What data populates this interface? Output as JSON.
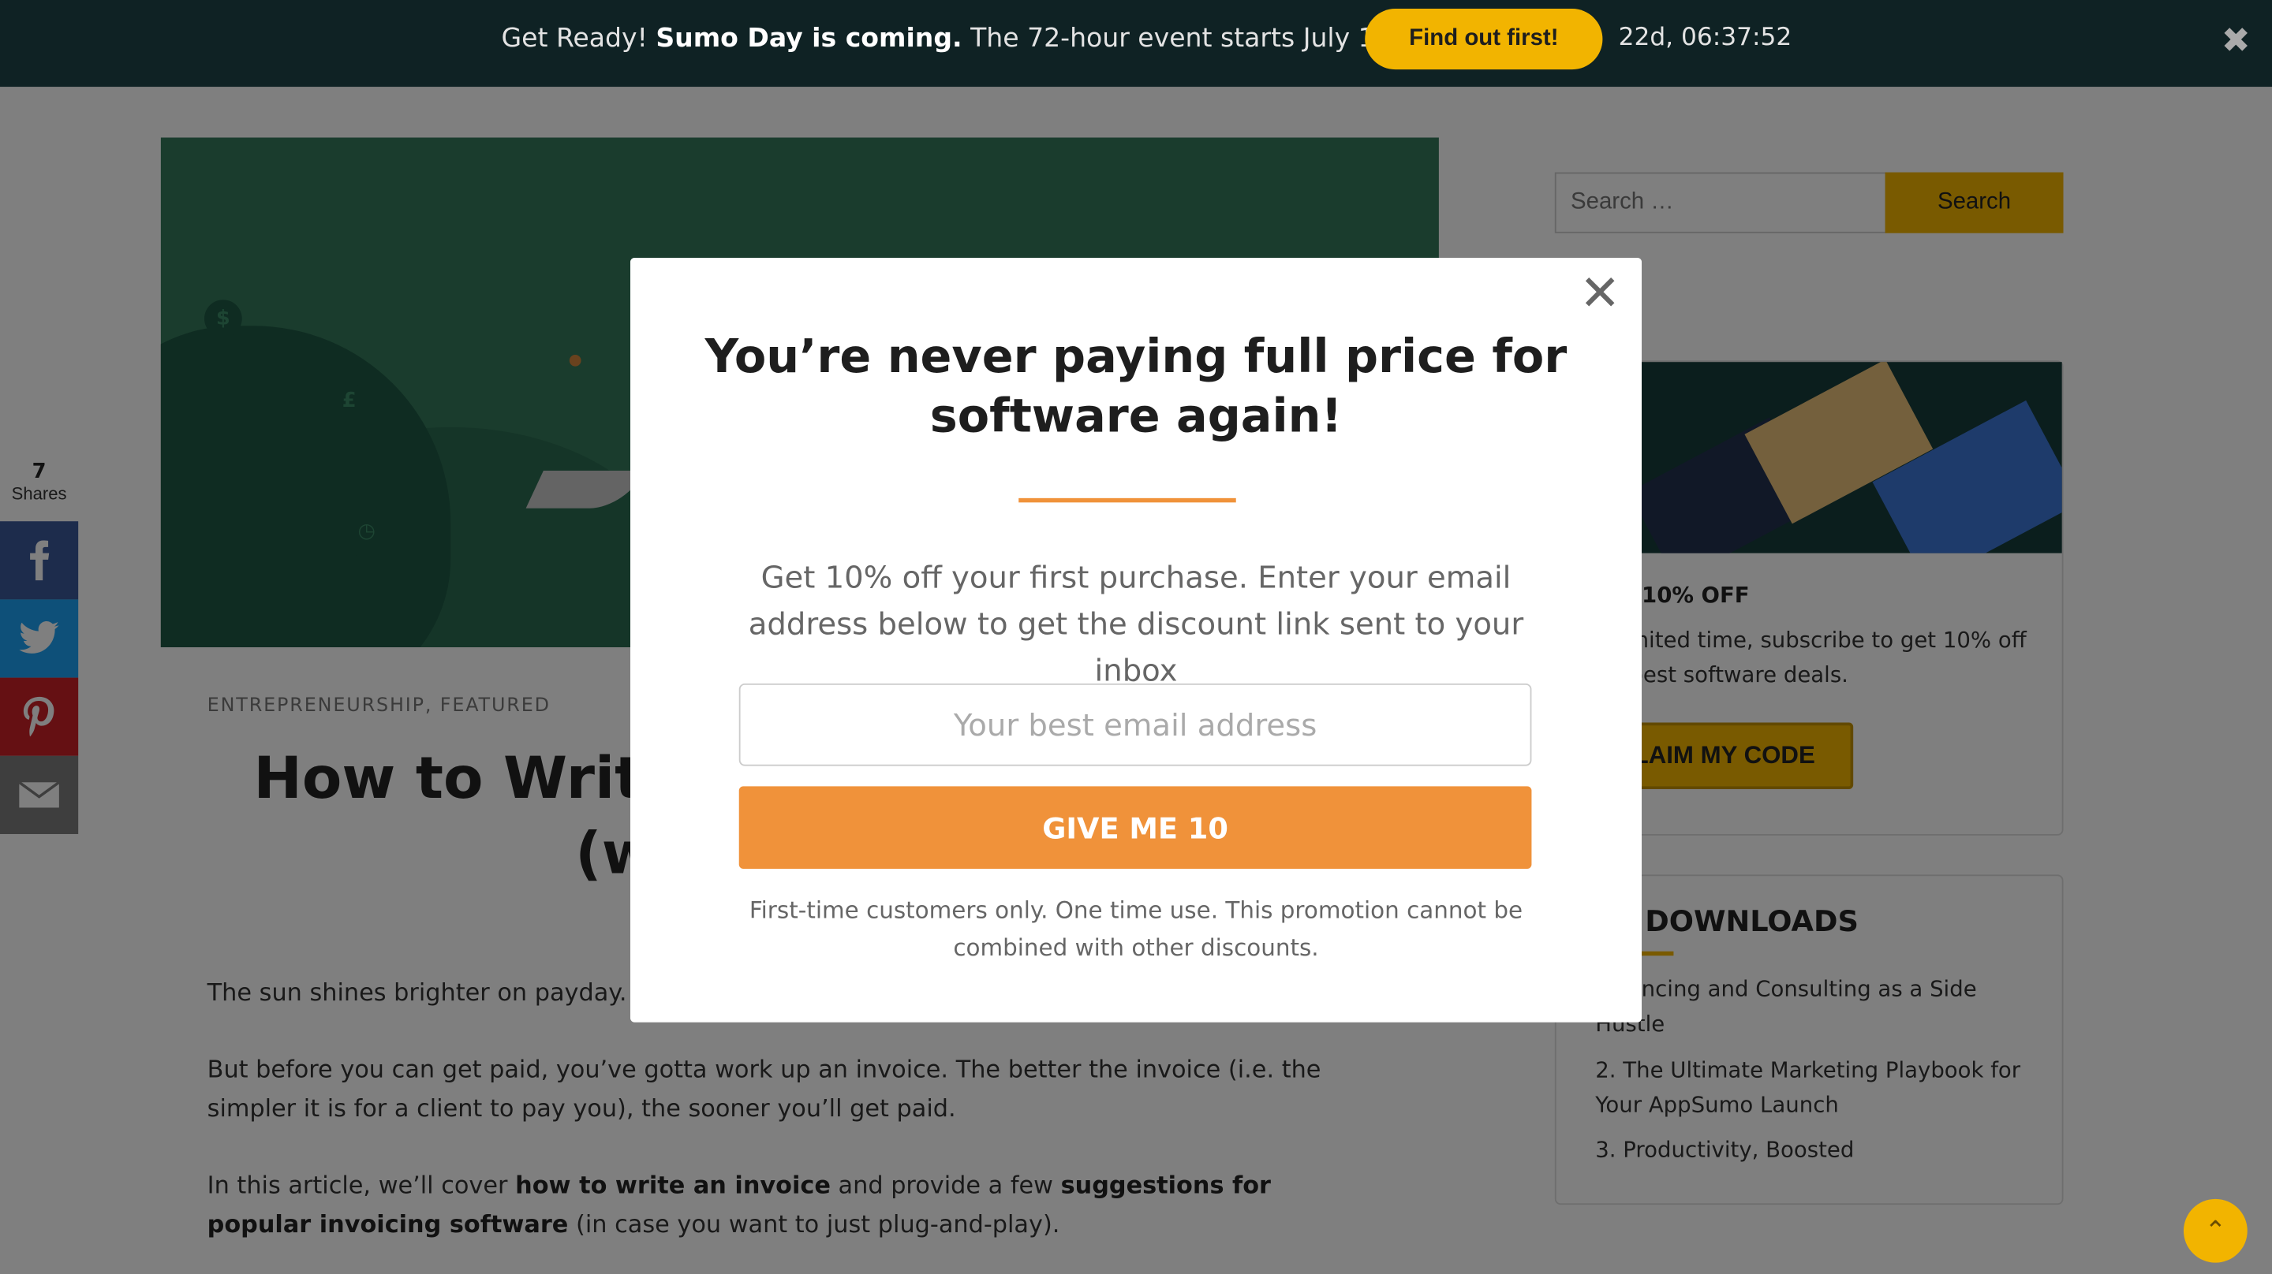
{
  "banner": {
    "lead": "Get Ready! ",
    "bold": "Sumo Day is coming.",
    "tail": " The 72-hour event starts July 13, 2021.",
    "cta_label": "Find out first!",
    "countdown": "22d, 06:37:52",
    "close_glyph": "✖"
  },
  "article": {
    "categories": "ENTREPRENEURSHIP, FEATURED",
    "title_line1": "How to Write a",
    "title_line2": "(w",
    "p1": "The sun shines brighter on payday.",
    "p2": "But before you can get paid, you’ve gotta work up an invoice. The better the invoice (i.e. the simpler it is for a client to pay you), the sooner you’ll get paid.",
    "p3_a": "In this article, we’ll cover ",
    "p3_b": "how to write an invoice",
    "p3_c": " and provide a few ",
    "p3_d": "suggestions for popular invoicing software",
    "p3_e": " (in case you want to just plug-and-play)."
  },
  "share": {
    "count": "7",
    "label": "Shares",
    "colors": {
      "facebook": "#3b5998",
      "twitter": "#1da1f2",
      "pinterest": "#cb2027",
      "email": "#7d7d7d"
    }
  },
  "sidebar": {
    "search_placeholder": "Search …",
    "search_button": "Search",
    "promo_title": "10% OFF",
    "promo_text": "a limited time, subscribe to get 10% off he best software deals.",
    "promo_button": "LAIM MY CODE",
    "downloads_title": "EE DOWNLOADS",
    "downloads": [
      "eelancing and Consulting as a Side Hustle",
      "2. The Ultimate Marketing Playbook for Your AppSumo Launch",
      "3. Productivity, Boosted"
    ]
  },
  "modal": {
    "heading": "You’re never paying full price for software again!",
    "subtext": "Get 10% off your first purchase. Enter your email address below to get the discount link sent to your inbox",
    "email_placeholder": "Your best email address",
    "button": "GIVE ME 10",
    "fine_print": "First-time customers only. One time use. This promotion cannot be combined with other discounts.",
    "close_glyph": "✕"
  },
  "scroll_top_glyph": "⌃",
  "accent_colors": {
    "brand_yellow": "#f2b400",
    "modal_orange": "#f0923a",
    "banner_bg": "#0f2224"
  }
}
